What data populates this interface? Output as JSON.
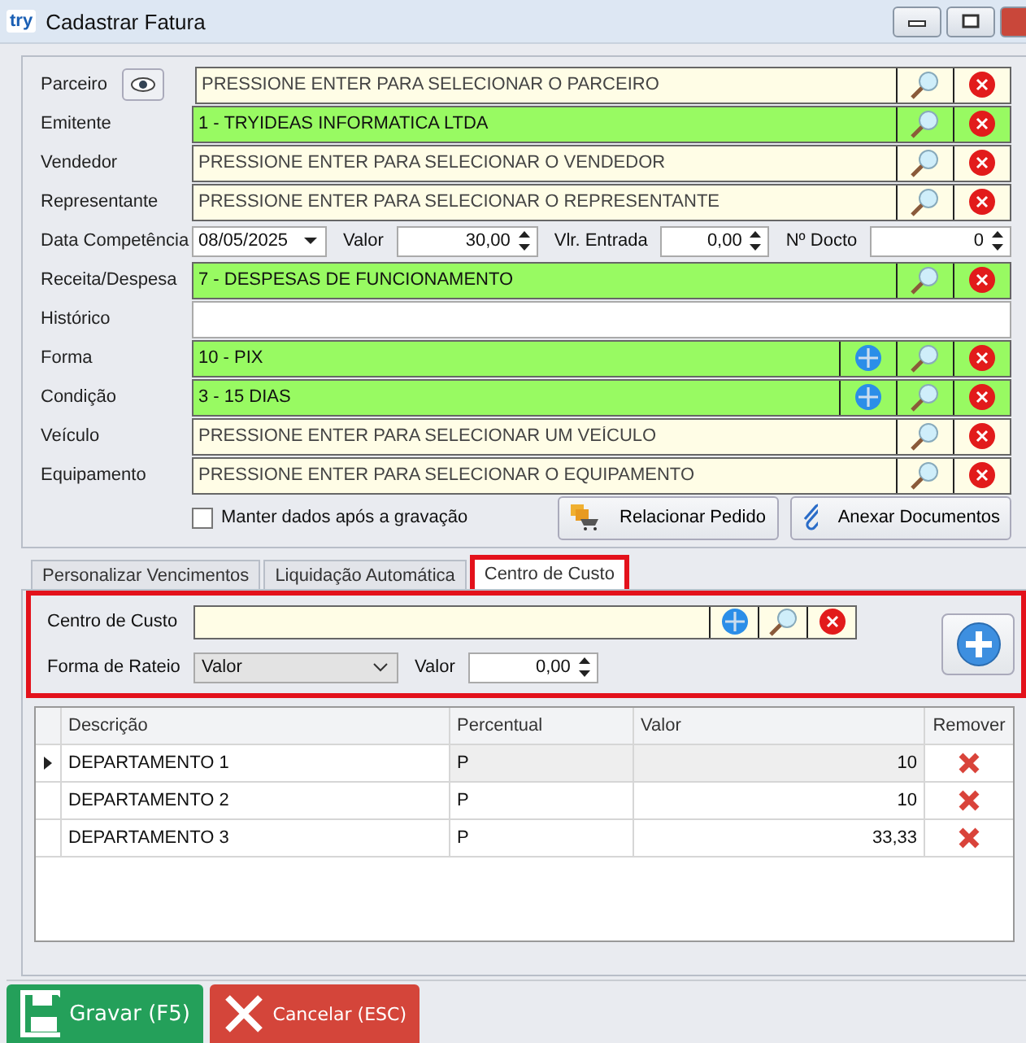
{
  "window": {
    "logo": "try",
    "title": "Cadastrar Fatura"
  },
  "form": {
    "rows": [
      {
        "kind": "lookup",
        "label": "Parceiro",
        "placeholder": "PRESSIONE ENTER PARA SELECIONAR O PARCEIRO",
        "filled": false,
        "view_button": true,
        "add_button": false
      },
      {
        "kind": "lookup",
        "label": "Emitente",
        "value": "1 - TRYIDEAS INFORMATICA LTDA",
        "filled": true,
        "view_button": false,
        "add_button": false
      },
      {
        "kind": "lookup",
        "label": "Vendedor",
        "placeholder": "PRESSIONE ENTER PARA SELECIONAR O VENDEDOR",
        "filled": false,
        "view_button": false,
        "add_button": false
      },
      {
        "kind": "lookup",
        "label": "Representante",
        "placeholder": "PRESSIONE ENTER PARA SELECIONAR O REPRESENTANTE",
        "filled": false,
        "view_button": false,
        "add_button": false
      },
      {
        "kind": "values",
        "label": "Data Competência",
        "date": "08/05/2025",
        "fields": [
          {
            "label": "Valor",
            "value": "30,00"
          },
          {
            "label": "Vlr. Entrada",
            "value": "0,00"
          },
          {
            "label": "Nº Docto",
            "value": "0"
          }
        ]
      },
      {
        "kind": "lookup",
        "label": "Receita/Despesa",
        "value": "7 - DESPESAS DE FUNCIONAMENTO",
        "filled": true,
        "view_button": false,
        "add_button": false
      },
      {
        "kind": "text",
        "label": "Histórico"
      },
      {
        "kind": "lookup",
        "label": "Forma",
        "value": "10 - PIX",
        "filled": true,
        "view_button": false,
        "add_button": true
      },
      {
        "kind": "lookup",
        "label": "Condição",
        "value": "3 - 15 DIAS",
        "filled": true,
        "view_button": false,
        "add_button": true
      },
      {
        "kind": "lookup",
        "label": "Veículo",
        "placeholder": "PRESSIONE ENTER PARA SELECIONAR UM VEÍCULO",
        "filled": false,
        "view_button": false,
        "add_button": false
      },
      {
        "kind": "lookup",
        "label": "Equipamento",
        "placeholder": "PRESSIONE ENTER PARA SELECIONAR O EQUIPAMENTO",
        "filled": false,
        "view_button": false,
        "add_button": false
      }
    ],
    "keep_data": {
      "label": "Manter dados após a gravação",
      "checked": false
    },
    "buttons": [
      {
        "kind": "order",
        "label": "Relacionar Pedido"
      },
      {
        "kind": "attach",
        "label": "Anexar Documentos"
      }
    ]
  },
  "tabs": [
    {
      "label": "Personalizar Vencimentos",
      "selected": false
    },
    {
      "label": "Liquidação Automática",
      "selected": false
    },
    {
      "label": "Centro de Custo",
      "selected": true
    }
  ],
  "cost_center": {
    "highlighted": true,
    "label": "Centro de Custo",
    "apportion_label": "Forma de Rateio",
    "apportion": "Valor",
    "value_label": "Valor",
    "value": "0,00"
  },
  "table": {
    "columns": [
      "Descrição",
      "Percentual",
      "Valor",
      "Remover"
    ],
    "rows": [
      {
        "cells": [
          "DEPARTAMENTO 1",
          "P",
          "10"
        ],
        "selected": true
      },
      {
        "cells": [
          "DEPARTAMENTO 2",
          "P",
          "10"
        ],
        "selected": false
      },
      {
        "cells": [
          "DEPARTAMENTO 3",
          "P",
          "33,33"
        ],
        "selected": false
      }
    ]
  },
  "footer": [
    {
      "kind": "save",
      "label": "Gravar (F5)"
    },
    {
      "kind": "cancel",
      "label": "Cancelar (ESC)"
    }
  ]
}
